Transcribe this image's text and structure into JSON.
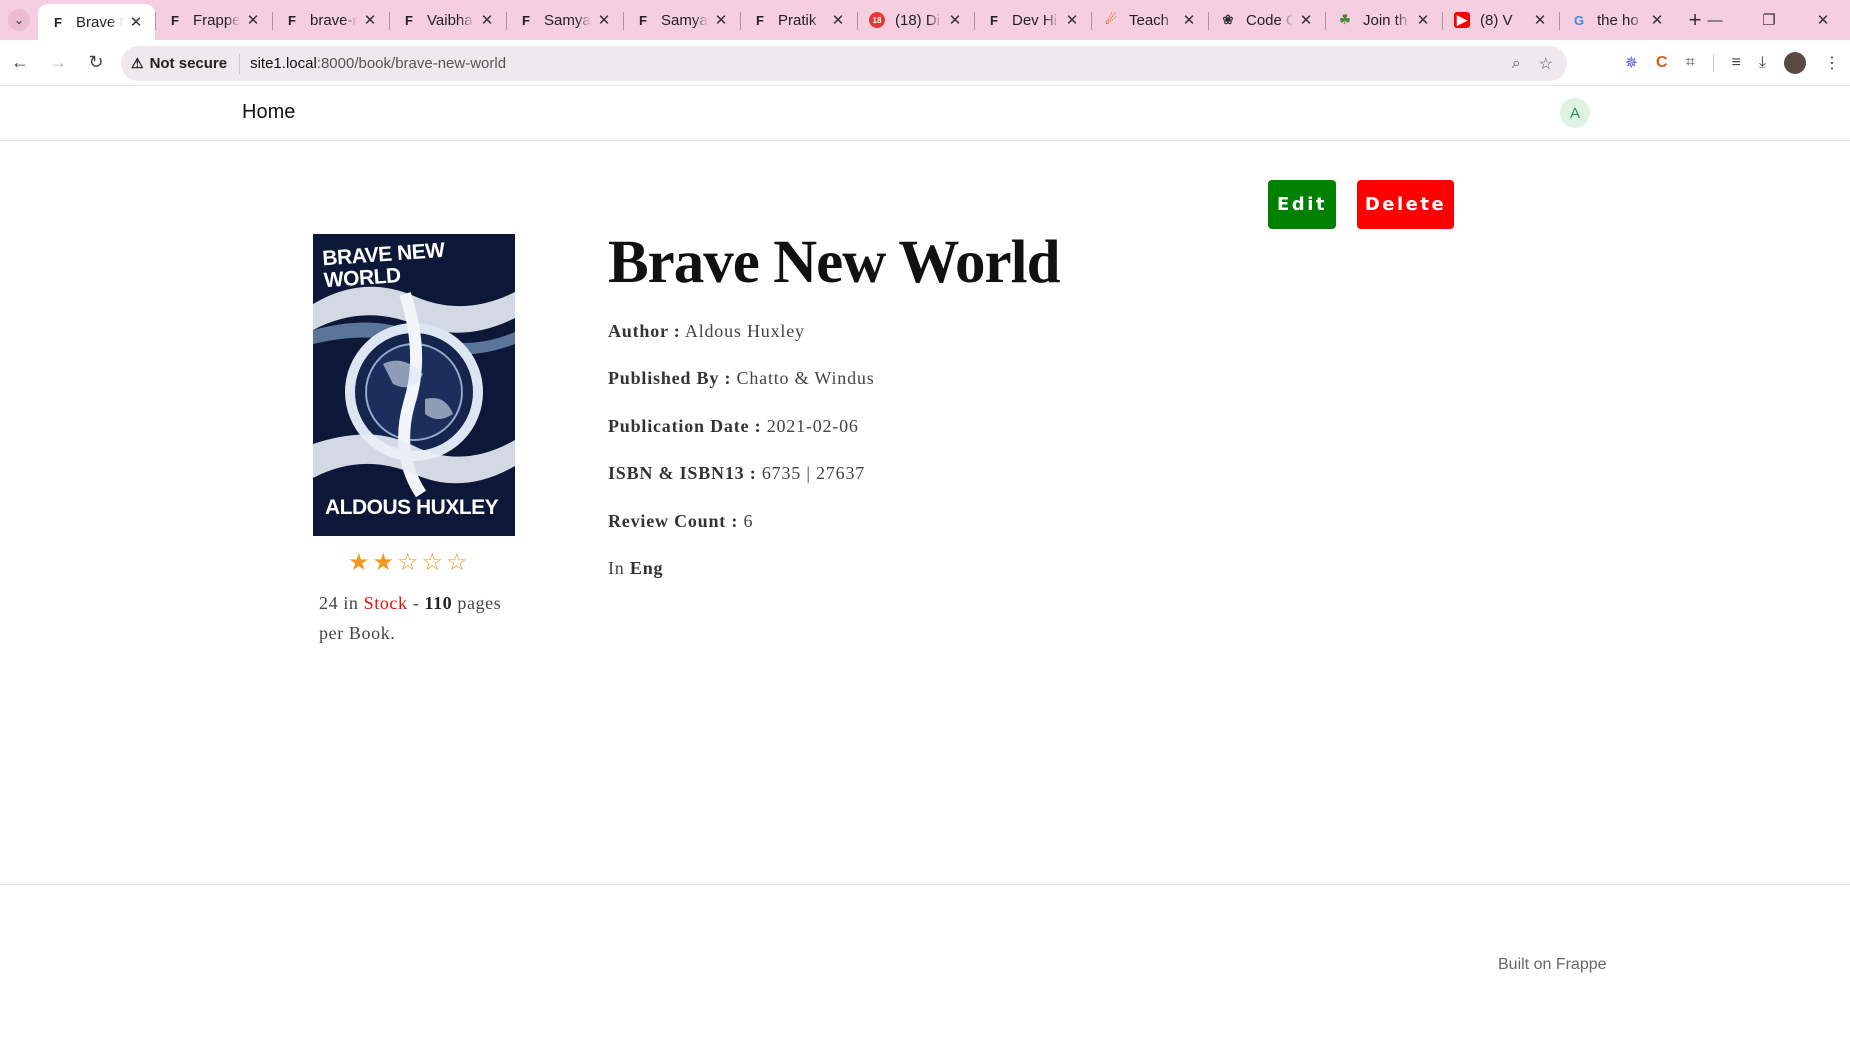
{
  "browser": {
    "tabs": [
      {
        "title": "Brave New World",
        "favicon": "frappe-icon",
        "active": true
      },
      {
        "title": "Frappe",
        "favicon": "frappe-icon",
        "active": false
      },
      {
        "title": "brave-new-world",
        "favicon": "frappe-icon",
        "active": false
      },
      {
        "title": "Vaibhav",
        "favicon": "frappe-icon",
        "active": false
      },
      {
        "title": "Samyak",
        "favicon": "frappe-icon",
        "active": false
      },
      {
        "title": "Samyak",
        "favicon": "frappe-icon",
        "active": false
      },
      {
        "title": "Pratik",
        "favicon": "frappe-icon",
        "active": false
      },
      {
        "title": "(18) Di",
        "favicon": "notification-icon",
        "active": false
      },
      {
        "title": "Dev Hi",
        "favicon": "frappe-icon",
        "active": false
      },
      {
        "title": "Teach",
        "favicon": "rocket-icon",
        "active": false
      },
      {
        "title": "Code C",
        "favicon": "openai-icon",
        "active": false
      },
      {
        "title": "Join th",
        "favicon": "leaf-icon",
        "active": false
      },
      {
        "title": "(8) V",
        "favicon": "youtube-icon",
        "active": false
      },
      {
        "title": "the ho",
        "favicon": "google-icon",
        "active": false
      }
    ],
    "security_label": "Not secure",
    "url_host": "site1.local",
    "url_path": ":8000/book/brave-new-world"
  },
  "nav": {
    "home_label": "Home",
    "avatar_initial": "A"
  },
  "actions": {
    "edit_label": "Edit",
    "delete_label": "Delete"
  },
  "book": {
    "title": "Brave New World",
    "cover_text_top": "BRAVE NEW WORLD",
    "cover_text_bottom": "ALDOUS HUXLEY",
    "rating": 2,
    "rating_max": 5,
    "stock_count": "24",
    "stock_in": "in",
    "stock_word": "Stock",
    "stock_dash": "-",
    "pages": "110",
    "pages_suffix": "pages per Book.",
    "author_label": "Author :",
    "author": "Aldous Huxley",
    "publisher_label": "Published By :",
    "publisher": "Chatto & Windus",
    "date_label": "Publication Date :",
    "date": "2021-02-06",
    "isbn_label": "ISBN & ISBN13 :",
    "isbn": "6735 | 27637",
    "review_label": "Review Count :",
    "review_count": "6",
    "language_prefix": "In",
    "language": "Eng"
  },
  "footer": {
    "built_on": "Built on Frappe"
  },
  "colors": {
    "edit_button": "#008000",
    "delete_button": "#ff0000",
    "stock_highlight": "#e3120b",
    "star": "#f29a1f",
    "tab_strip": "#f5cfe0"
  }
}
